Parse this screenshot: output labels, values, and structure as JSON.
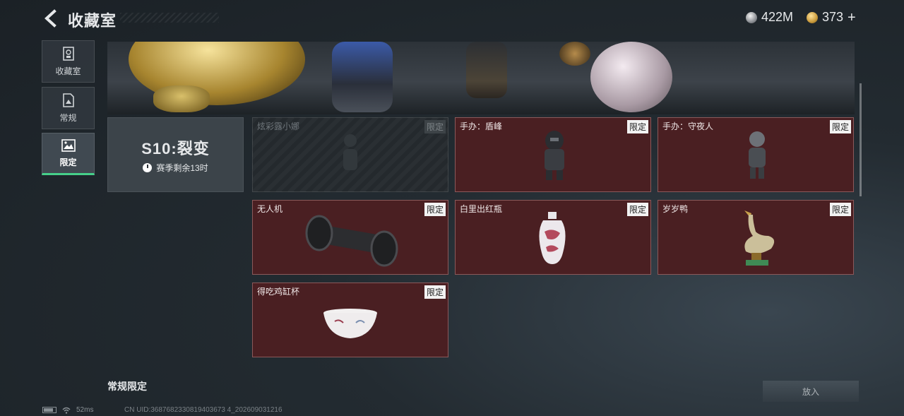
{
  "header": {
    "title": "收藏室",
    "currencies": [
      {
        "icon": "silver-coin-icon",
        "value": "422M"
      },
      {
        "icon": "gold-coin-icon",
        "value": "373"
      }
    ]
  },
  "sidebar": {
    "items": [
      {
        "label": "收藏室",
        "icon": "collection-icon",
        "active": false
      },
      {
        "label": "常规",
        "icon": "regular-icon",
        "active": false
      },
      {
        "label": "限定",
        "icon": "limited-icon",
        "active": true
      }
    ]
  },
  "season": {
    "title": "S10:裂变",
    "remaining": "赛季剩余13时"
  },
  "cards": [
    {
      "name": "炫彩露小娜",
      "tag": "限定",
      "disabled": true
    },
    {
      "name": "手办：盾峰",
      "tag": "限定",
      "disabled": false
    },
    {
      "name": "手办：守夜人",
      "tag": "限定",
      "disabled": false
    },
    {
      "name": "无人机",
      "tag": "限定",
      "disabled": false
    },
    {
      "name": "白里出红瓶",
      "tag": "限定",
      "disabled": false
    },
    {
      "name": "岁岁鸭",
      "tag": "限定",
      "disabled": false
    },
    {
      "name": "得吃鸡缸杯",
      "tag": "限定",
      "disabled": false
    }
  ],
  "section": {
    "title": "常规限定"
  },
  "put_button": {
    "label": "放入"
  },
  "status_bar": {
    "ping": "52ms",
    "uid": "CN UID:3687682330819403673 4_202609031216"
  },
  "colors": {
    "accent_green": "#46d08a",
    "card_bg": "#4a1f22",
    "background": "#232b31"
  }
}
